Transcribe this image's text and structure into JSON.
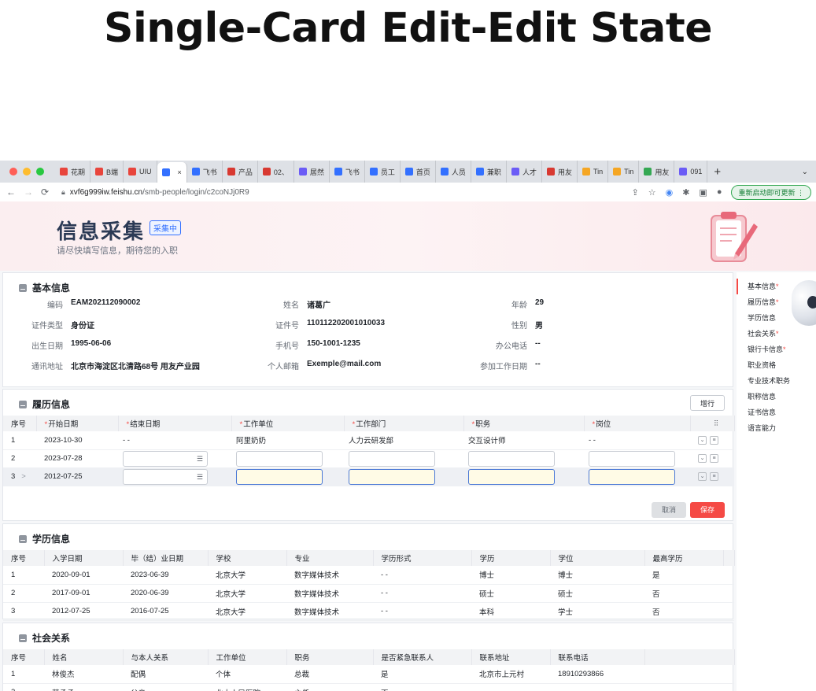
{
  "slide_title": "Single-Card Edit-Edit State",
  "browser": {
    "tabs": [
      {
        "label": "花期",
        "color": "#e8453c"
      },
      {
        "label": "B端",
        "color": "#e8453c"
      },
      {
        "label": "UIU",
        "color": "#e8453c"
      },
      {
        "label": "",
        "color": "#3370ff",
        "active": true
      },
      {
        "label": "飞书",
        "color": "#3370ff"
      },
      {
        "label": "产品",
        "color": "#d83931"
      },
      {
        "label": "02、",
        "color": "#d83931"
      },
      {
        "label": "居然",
        "color": "#6b5cf6"
      },
      {
        "label": "飞书",
        "color": "#3370ff"
      },
      {
        "label": "员工",
        "color": "#3370ff"
      },
      {
        "label": "首页",
        "color": "#3370ff"
      },
      {
        "label": "人员",
        "color": "#3370ff"
      },
      {
        "label": "兼职",
        "color": "#3370ff"
      },
      {
        "label": "人才",
        "color": "#6b5cf6"
      },
      {
        "label": "用友",
        "color": "#d83931"
      },
      {
        "label": "Tin",
        "color": "#f5a623"
      },
      {
        "label": "Tin",
        "color": "#f5a623"
      },
      {
        "label": "用友",
        "color": "#34a853"
      },
      {
        "label": "091",
        "color": "#6b5cf6"
      }
    ],
    "tab_close": "×",
    "new_tab": "+",
    "tab_menu": "⌄",
    "url_host": "xvf6g999iw.feishu.cn",
    "url_path": "/smb-people/login/c2coNJj0R9",
    "update_button": "重新启动即可更新",
    "update_more": "⋮"
  },
  "banner": {
    "title": "信息采集",
    "badge": "采集中",
    "subtitle": "请尽快填写信息，期待您的入职"
  },
  "basic_info": {
    "heading": "基本信息",
    "fields": [
      {
        "label": "编码",
        "value": "EAM202112090002"
      },
      {
        "label": "姓名",
        "value": "诸葛广"
      },
      {
        "label": "年龄",
        "value": "29"
      },
      {
        "label": "证件类型",
        "value": "身份证"
      },
      {
        "label": "证件号",
        "value": "110112202001010033"
      },
      {
        "label": "性别",
        "value": "男"
      },
      {
        "label": "出生日期",
        "value": "1995-06-06"
      },
      {
        "label": "手机号",
        "value": "150-1001-1235"
      },
      {
        "label": "办公电话",
        "value": "--"
      },
      {
        "label": "通讯地址",
        "value": "北京市海淀区北清路68号 用友产业园"
      },
      {
        "label": "个人邮箱",
        "value": "Exemple@mail.com"
      },
      {
        "label": "参加工作日期",
        "value": "--"
      }
    ]
  },
  "resume": {
    "heading": "履历信息",
    "add_row": "增行",
    "columns": [
      "序号",
      "开始日期",
      "结束日期",
      "工作单位",
      "工作部门",
      "职务",
      "岗位"
    ],
    "rows": [
      {
        "no": "1",
        "start": "2023-10-30",
        "end": "- -",
        "company": "阿里奶奶",
        "dept": "人力云研发部",
        "title": "交互设计师",
        "post": "- -"
      },
      {
        "no": "2",
        "start": "2023-07-28"
      },
      {
        "no": "3",
        "expand": ">",
        "start": "2012-07-25"
      }
    ],
    "cancel": "取消",
    "save": "保存"
  },
  "education": {
    "heading": "学历信息",
    "columns": [
      "序号",
      "入学日期",
      "毕（结）业日期",
      "学校",
      "专业",
      "学历形式",
      "学历",
      "学位",
      "最高学历"
    ],
    "rows": [
      [
        "1",
        "2020-09-01",
        "2023-06-39",
        "北京大学",
        "数字媒体技术",
        "- -",
        "博士",
        "博士",
        "是"
      ],
      [
        "2",
        "2017-09-01",
        "2020-06-39",
        "北京大学",
        "数字媒体技术",
        "- -",
        "硕士",
        "硕士",
        "否"
      ],
      [
        "3",
        "2012-07-25",
        "2016-07-25",
        "北京大学",
        "数字媒体技术",
        "- -",
        "本科",
        "学士",
        "否"
      ]
    ]
  },
  "social": {
    "heading": "社会关系",
    "columns": [
      "序号",
      "姓名",
      "与本人关系",
      "工作单位",
      "职务",
      "是否紧急联系人",
      "联系地址",
      "联系电话"
    ],
    "rows": [
      [
        "1",
        "林俊杰",
        "配偶",
        "个体",
        "总裁",
        "是",
        "北京市上元村",
        "18910293866"
      ],
      [
        "2",
        "范承承",
        "父亲",
        "北大人民医院",
        "主任",
        "否",
        "",
        ""
      ]
    ]
  },
  "side_nav": [
    {
      "label": "基本信息",
      "required": true,
      "active": true
    },
    {
      "label": "履历信息",
      "required": true
    },
    {
      "label": "学历信息"
    },
    {
      "label": "社会关系",
      "required": true
    },
    {
      "label": "银行卡信息",
      "required": true
    },
    {
      "label": "职业资格"
    },
    {
      "label": "专业技术职务"
    },
    {
      "label": "职称信息"
    },
    {
      "label": "证书信息"
    },
    {
      "label": "语言能力"
    }
  ],
  "colors": {
    "accent": "#3370ff",
    "danger": "#f54a45",
    "title_dark": "#2b3a55"
  }
}
